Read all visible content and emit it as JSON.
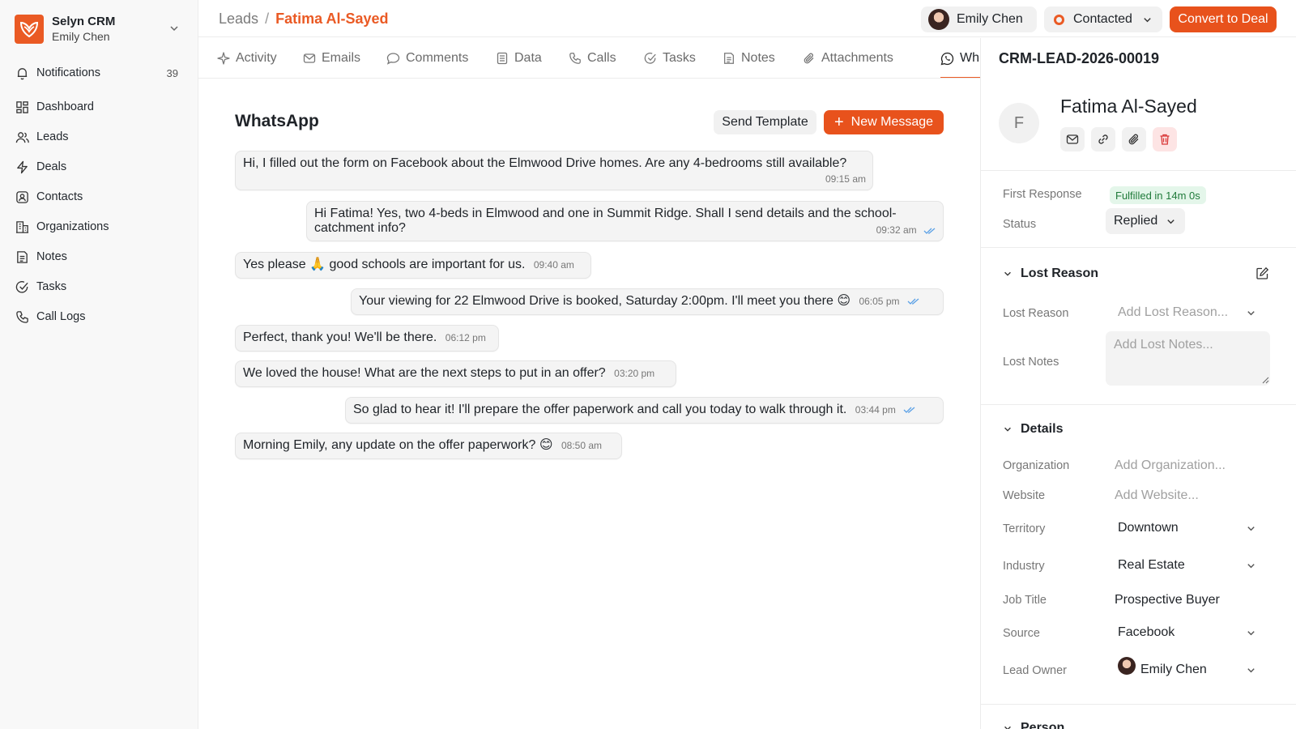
{
  "brand": {
    "name": "Selyn CRM",
    "user": "Emily Chen",
    "accent": "#ea5a24"
  },
  "nav": {
    "notifications": {
      "label": "Notifications",
      "count": "39"
    },
    "items": [
      {
        "label": "Dashboard",
        "icon": "dashboard-icon"
      },
      {
        "label": "Leads",
        "icon": "users-icon"
      },
      {
        "label": "Deals",
        "icon": "lightning-icon"
      },
      {
        "label": "Contacts",
        "icon": "contact-card-icon"
      },
      {
        "label": "Organizations",
        "icon": "building-icon"
      },
      {
        "label": "Notes",
        "icon": "note-icon"
      },
      {
        "label": "Tasks",
        "icon": "check-circle-icon"
      },
      {
        "label": "Call Logs",
        "icon": "phone-icon"
      }
    ]
  },
  "header": {
    "breadcrumb_root": "Leads",
    "breadcrumb_sep": "/",
    "breadcrumb_current": "Fatima Al-Sayed",
    "assignee": "Emily Chen",
    "status": "Contacted",
    "convert_label": "Convert to Deal"
  },
  "tabs": [
    {
      "label": "Activity",
      "icon": "activity-icon"
    },
    {
      "label": "Emails",
      "icon": "mail-icon"
    },
    {
      "label": "Comments",
      "icon": "comment-icon"
    },
    {
      "label": "Data",
      "icon": "data-icon"
    },
    {
      "label": "Calls",
      "icon": "phone-icon"
    },
    {
      "label": "Tasks",
      "icon": "check-circle-icon"
    },
    {
      "label": "Notes",
      "icon": "note-icon"
    },
    {
      "label": "Attachments",
      "icon": "paperclip-icon"
    },
    {
      "label": "Wh",
      "icon": "whatsapp-icon"
    }
  ],
  "whatsapp": {
    "title": "WhatsApp",
    "send_template_label": "Send Template",
    "new_message_label": "New Message",
    "messages": [
      {
        "text": "Hi, I filled out the form on Facebook about the Elmwood Drive homes. Are any 4-bedrooms still available?",
        "time": "09:15 am",
        "direction": "in"
      },
      {
        "text": "Hi Fatima! Yes, two 4-beds in Elmwood and one in Summit Ridge. Shall I send details and the school-catchment info?",
        "time": "09:32 am",
        "direction": "out"
      },
      {
        "text": "Yes please 🙏  good schools are important for us.",
        "time": "09:40 am",
        "direction": "in"
      },
      {
        "text": "Your viewing for 22 Elmwood Drive is booked, Saturday 2:00pm. I'll meet you there 😊",
        "time": "06:05 pm",
        "direction": "out"
      },
      {
        "text": "Perfect, thank you! We'll be there.",
        "time": "06:12 pm",
        "direction": "in"
      },
      {
        "text": "We loved the house! What are the next steps to put in an offer?",
        "time": "03:20 pm",
        "direction": "in"
      },
      {
        "text": "So glad to hear it! I'll prepare the offer paperwork and call you today to walk through it.",
        "time": "03:44 pm",
        "direction": "out"
      },
      {
        "text": "Morning Emily, any update on the offer paperwork? 😊",
        "time": "08:50 am",
        "direction": "in"
      }
    ]
  },
  "panel": {
    "lead_id": "CRM-LEAD-2026-00019",
    "avatar_letter": "F",
    "lead_name": "Fatima Al-Sayed",
    "first_response_label": "First Response",
    "first_response_value": "Fulfilled in 14m 0s",
    "status_label": "Status",
    "status_value": "Replied",
    "lost_section_title": "Lost Reason",
    "lost_reason_label": "Lost Reason",
    "lost_reason_placeholder": "Add Lost Reason...",
    "lost_notes_label": "Lost Notes",
    "lost_notes_placeholder": "Add Lost Notes...",
    "details_title": "Details",
    "organization_label": "Organization",
    "organization_placeholder": "Add Organization...",
    "website_label": "Website",
    "website_placeholder": "Add Website...",
    "territory_label": "Territory",
    "territory_value": "Downtown",
    "industry_label": "Industry",
    "industry_value": "Real Estate",
    "job_title_label": "Job Title",
    "job_title_value": "Prospective Buyer",
    "source_label": "Source",
    "source_value": "Facebook",
    "lead_owner_label": "Lead Owner",
    "lead_owner_value": "Emily Chen",
    "person_title": "Person"
  }
}
